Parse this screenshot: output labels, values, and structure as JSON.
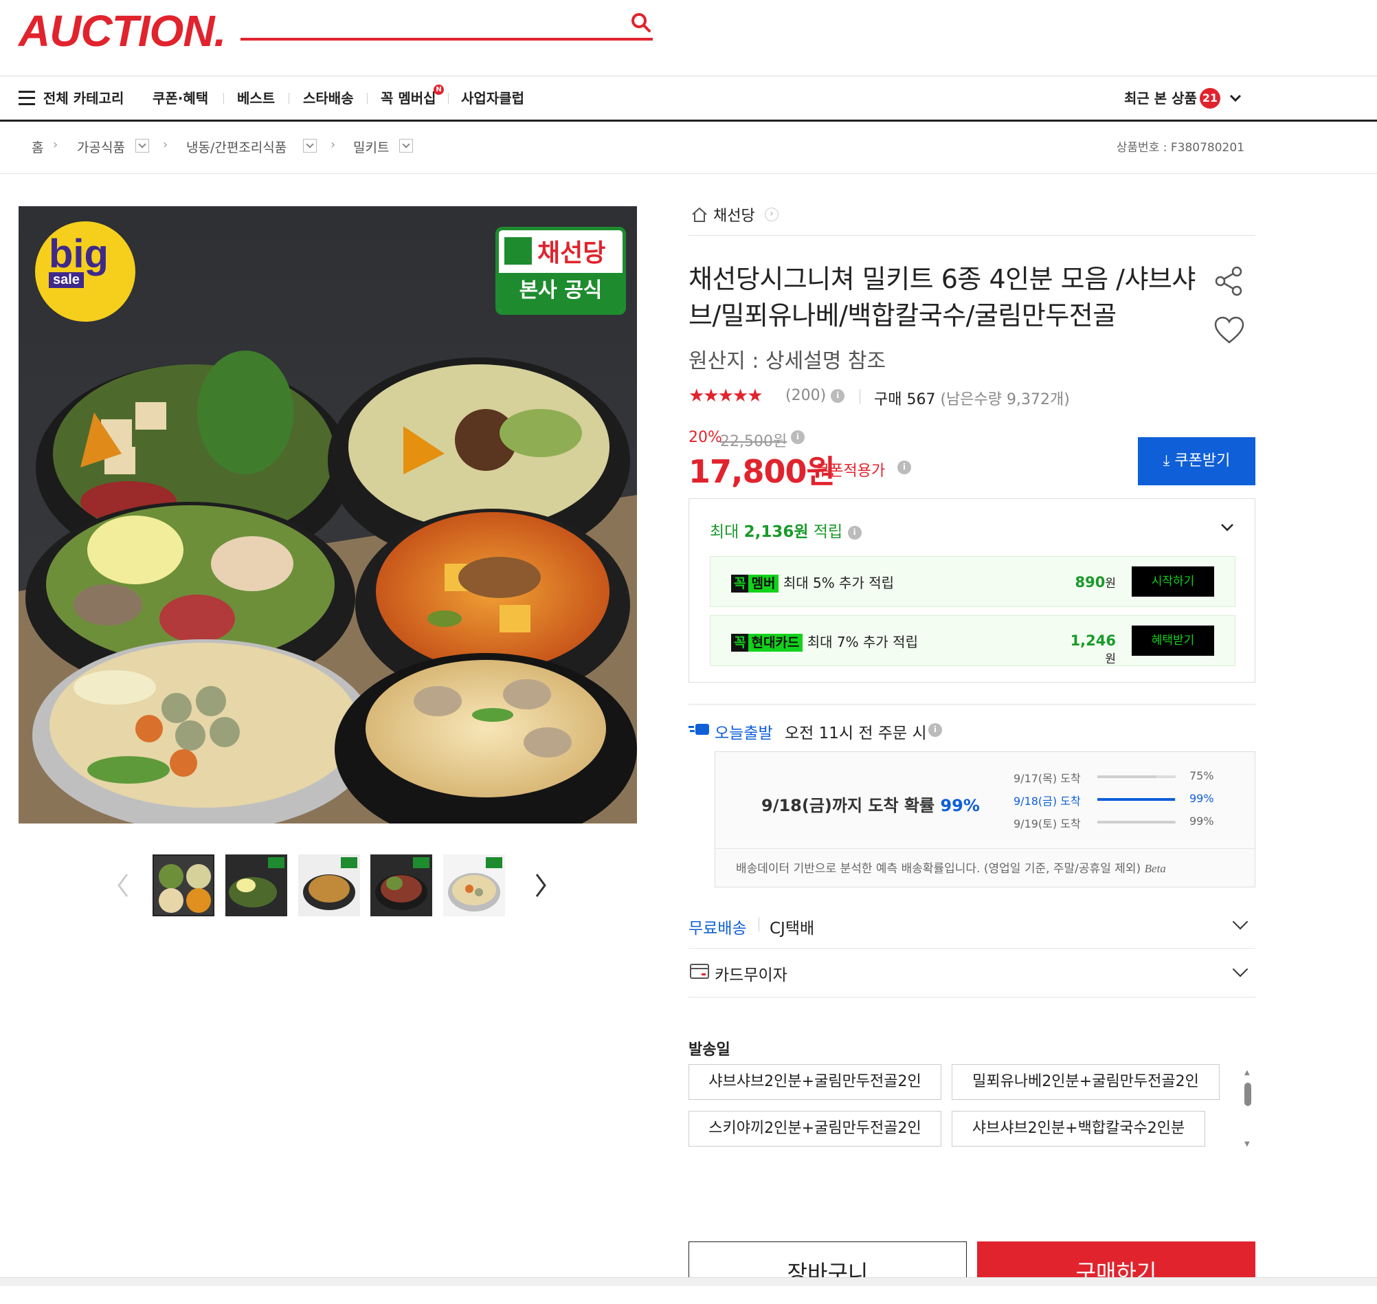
{
  "header": {
    "logo": "AUCTION."
  },
  "nav": {
    "all_categories": "전체 카테고리",
    "items": [
      "쿠폰·혜택",
      "베스트",
      "스타배송",
      "꼭 멤버십",
      "사업자클럽"
    ],
    "membership_badge": "N",
    "recent_label": "최근 본 상품",
    "recent_count": "21"
  },
  "breadcrumb": {
    "home": "홈",
    "items": [
      "가공식품",
      "냉동/간편조리식품",
      "밀키트"
    ],
    "product_no": "상품번호 : F380780201"
  },
  "image": {
    "big_badge": "big",
    "sale_badge": "sale",
    "brand_name": "채선당",
    "brand_sub": "본사 공식"
  },
  "product": {
    "seller": "채선당",
    "title": "채선당시그니쳐 밀키트 6종 4인분 모음 /샤브샤브/밀푀유나베/백합칼국수/굴림만두전골",
    "origin": "원산지 : 상세설명 참조",
    "stars": "★★★★★",
    "rating_count": "(200)",
    "buy_label": "구매 567",
    "remaining": "(남은수량 9,372개)",
    "discount": "20%",
    "original_price": "22,500원",
    "price": "17,800원",
    "coupon_price_label": "쿠폰적용가",
    "coupon_button": "쿠폰받기"
  },
  "rewards": {
    "head_prefix": "최대",
    "head_amount": "2,136원",
    "head_suffix": "적립",
    "rows": [
      {
        "pill_a": "꼭",
        "pill_b": "멤버",
        "text": "최대 5% 추가 적립",
        "amount": "890",
        "unit": "원",
        "button": "시작하기"
      },
      {
        "pill_a": "꼭",
        "pill_b": "현대카드",
        "text": "최대 7% 추가 적립",
        "amount": "1,246",
        "unit": "원",
        "button": "혜택받기"
      }
    ]
  },
  "delivery": {
    "today_label": "오늘출발",
    "today_text": "오전 11시 전 주문 시",
    "main_prefix": "9/18(금)까지 도착 확률",
    "main_pct": "99%",
    "rows": [
      {
        "label": "9/17(목) 도착",
        "pct": "75%",
        "value": 0.75,
        "highlight": false
      },
      {
        "label": "9/18(금) 도착",
        "pct": "99%",
        "value": 0.99,
        "highlight": true
      },
      {
        "label": "9/19(토) 도착",
        "pct": "99%",
        "value": 0.99,
        "highlight": false
      }
    ],
    "note": "배송데이터 기반으로 분석한 예측 배송확률입니다. (영업일 기준, 주말/공휴일 제외)",
    "beta": "Beta"
  },
  "shipping": {
    "free": "무료배송",
    "carrier": "CJ택배",
    "card": "카드무이자"
  },
  "options": {
    "title": "발송일",
    "items": [
      "샤브샤브2인분+굴림만두전골2인",
      "밀푀유나베2인분+굴림만두전골2인",
      "스키야끼2인분+굴림만두전골2인",
      "샤브샤브2인분+백합칼국수2인분"
    ]
  },
  "actions": {
    "cart": "장바구니",
    "buy": "구매하기"
  },
  "colors": {
    "brand_red": "#e1232d",
    "coupon_blue": "#0e5fd8",
    "reward_green": "#1a9a2a",
    "member_green": "#12d21b"
  }
}
